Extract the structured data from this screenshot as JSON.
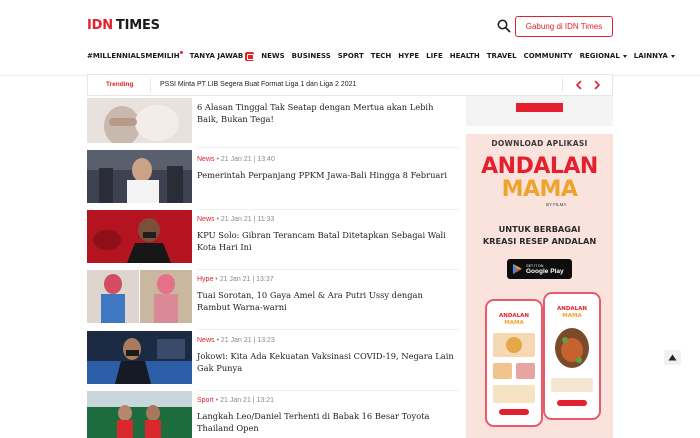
{
  "brand": {
    "logo_primary": "IDN",
    "logo_secondary": "TIMES",
    "accent_color": "#e5202e"
  },
  "header": {
    "join_label": "Gabung di IDN Times",
    "search_icon": "search-icon"
  },
  "nav": {
    "items": [
      {
        "label": "#MILLENNIALSMEMILIH"
      },
      {
        "label": "TANYA JAWAB"
      },
      {
        "label": "NEWS"
      },
      {
        "label": "BUSINESS"
      },
      {
        "label": "SPORT"
      },
      {
        "label": "TECH"
      },
      {
        "label": "HYPE"
      },
      {
        "label": "LIFE"
      },
      {
        "label": "HEALTH"
      },
      {
        "label": "TRAVEL"
      },
      {
        "label": "COMMUNITY"
      },
      {
        "label": "REGIONAL"
      },
      {
        "label": "LAINNYA"
      }
    ]
  },
  "trending": {
    "label": "Trending",
    "headline": "PSSI Minta PT LIB Segera Buat Format Liga 1 dan Liga 2 2021"
  },
  "articles": [
    {
      "category": "",
      "date": "",
      "title": "6 Alasan Tinggal Tak Seatap dengan Mertua akan Lebih Baik, Bukan Tega!"
    },
    {
      "category": "News",
      "date": "• 21 Jan 21 | 13:40",
      "title": "Pemerintah Perpanjang PPKM Jawa-Bali Hingga 8 Februari"
    },
    {
      "category": "News",
      "date": "• 21 Jan 21 | 11:33",
      "title": "KPU Solo: Gibran Terancam Batal Ditetapkan Sebagai Wali Kota Hari Ini"
    },
    {
      "category": "Hype",
      "date": "• 21 Jan 21 | 13:37",
      "title": "Tuai Sorotan, 10 Gaya Amel & Ara Putri Ussy dengan Rambut Warna-warni"
    },
    {
      "category": "News",
      "date": "• 21 Jan 21 | 13:23",
      "title": "Jokowi: Kita Ada Kekuatan Vaksinasi COVID-19, Negara Lain Gak Punya"
    },
    {
      "category": "Sport",
      "date": "• 21 Jan 21 | 13:21",
      "title": "Langkah Leo/Daniel Terhenti di Babak 16 Besar Toyota Thailand Open"
    }
  ],
  "ad": {
    "header": "DOWNLOAD APLIKASI",
    "brand_line1": "ANDALAN",
    "brand_line2": "MAMA",
    "by": "BY FILMA",
    "tagline_line1": "UNTUK BERBAGAI",
    "tagline_line2": "KREASI RESEP ANDALAN",
    "store_small": "GET IT ON",
    "store_big": "Google Play",
    "phone_title_1": "ANDALAN",
    "phone_title_2": "MAMA"
  }
}
